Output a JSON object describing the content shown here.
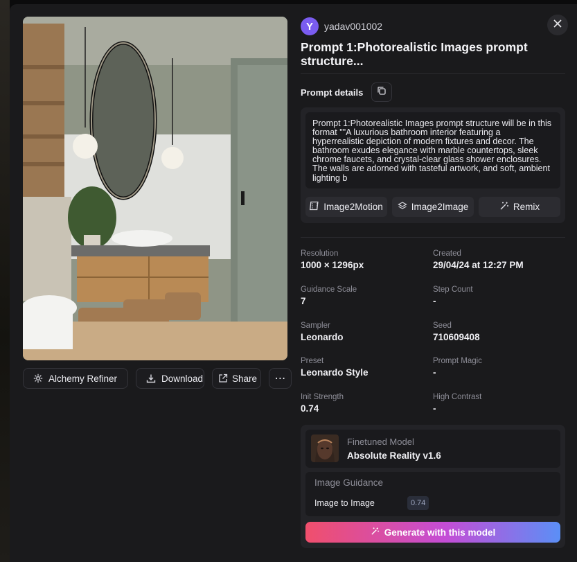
{
  "user": {
    "avatar_letter": "Y",
    "username": "yadav001002",
    "avatar_color": "#7a5cf0"
  },
  "title": "Prompt 1:Photorealistic Images prompt structure...",
  "prompt_details": {
    "label": "Prompt details",
    "text": "Prompt 1:Photorealistic Images prompt structure will be in this format \"\"A luxurious bathroom interior featuring a hyperrealistic depiction of modern fixtures and decor. The bathroom exudes elegance with marble countertops, sleek chrome faucets, and crystal-clear glass shower enclosures. The walls are adorned with tasteful artwork, and soft, ambient lighting b",
    "actions": {
      "image2motion": "Image2Motion",
      "image2image": "Image2Image",
      "remix": "Remix"
    }
  },
  "image_actions": {
    "alchemy_refiner": "Alchemy Refiner",
    "download": "Download",
    "share": "Share",
    "more": "⋯"
  },
  "meta": {
    "resolution": {
      "label": "Resolution",
      "value": "1000 × 1296px"
    },
    "created": {
      "label": "Created",
      "value": "29/04/24 at 12:27 PM"
    },
    "guidance_scale": {
      "label": "Guidance Scale",
      "value": "7"
    },
    "step_count": {
      "label": "Step Count",
      "value": "-"
    },
    "sampler": {
      "label": "Sampler",
      "value": "Leonardo"
    },
    "seed": {
      "label": "Seed",
      "value": "710609408"
    },
    "preset": {
      "label": "Preset",
      "value": "Leonardo Style"
    },
    "prompt_magic": {
      "label": "Prompt Magic",
      "value": "-"
    },
    "init_strength": {
      "label": "Init Strength",
      "value": "0.74"
    },
    "high_contrast": {
      "label": "High Contrast",
      "value": "-"
    }
  },
  "model": {
    "finetuned_label": "Finetuned Model",
    "finetuned_name": "Absolute Reality v1.6",
    "image_guidance_label": "Image Guidance",
    "image_to_image_label": "Image to Image",
    "image_to_image_value": "0.74",
    "generate_label": "Generate with this model"
  },
  "colors": {
    "modal_bg": "#1a1a1c",
    "card_bg": "#232327",
    "accent_gradient": [
      "#f04f6c",
      "#c44dd6",
      "#5b8ff6"
    ]
  }
}
